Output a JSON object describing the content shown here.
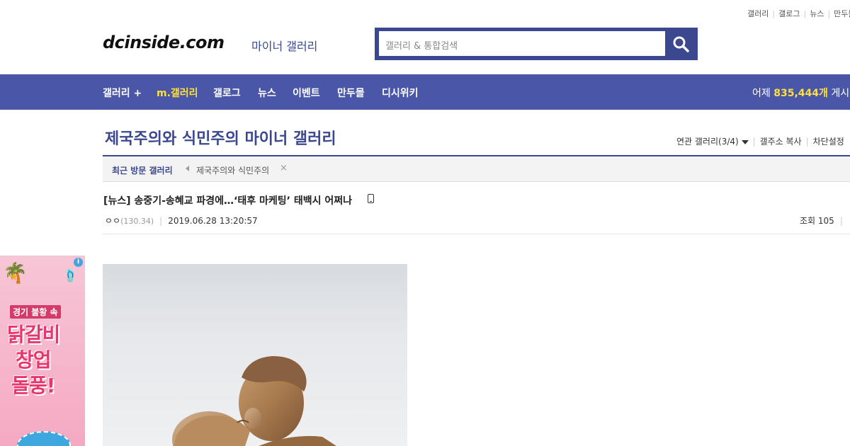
{
  "top_links": [
    "갤러리",
    "갤로그",
    "뉴스",
    "만두몰"
  ],
  "logo": "dcinside.com",
  "logo_sub": "마이너 갤러리",
  "search": {
    "placeholder": "갤러리 & 통합검색",
    "icon": "search-icon"
  },
  "nav": {
    "items": [
      "갤러리 +",
      "m.갤러리",
      "갤로그",
      "뉴스",
      "이벤트",
      "만두몰",
      "디시위키"
    ],
    "stat_label": "어제",
    "stat_value": "835,444개",
    "stat_suffix": "게시글"
  },
  "gallery": {
    "title": "제국주의와 식민주의 마이너 갤러리",
    "tools": [
      "연관 갤러리(3/4)",
      "갤주소 복사",
      "차단설정"
    ]
  },
  "recent": {
    "label": "최근 방문 갤러리",
    "item": "제국주의와 식민주의"
  },
  "post": {
    "title": "[뉴스] 송중기-송혜교 파경에…‘태후 마케팅’ 태백시 어쩌나",
    "author": "ㅇㅇ",
    "ip": "(130.34)",
    "datetime": "2019.06.28 13:20:57",
    "views_label": "조회 105"
  },
  "ad": {
    "line1": "경기 불황 속",
    "line2": "닭갈비",
    "line3": "창업",
    "line4": "돌풍!"
  },
  "colors": {
    "brand": "#3b4890",
    "nav_bg": "#4a57a8",
    "highlight": "#ffe03a"
  }
}
